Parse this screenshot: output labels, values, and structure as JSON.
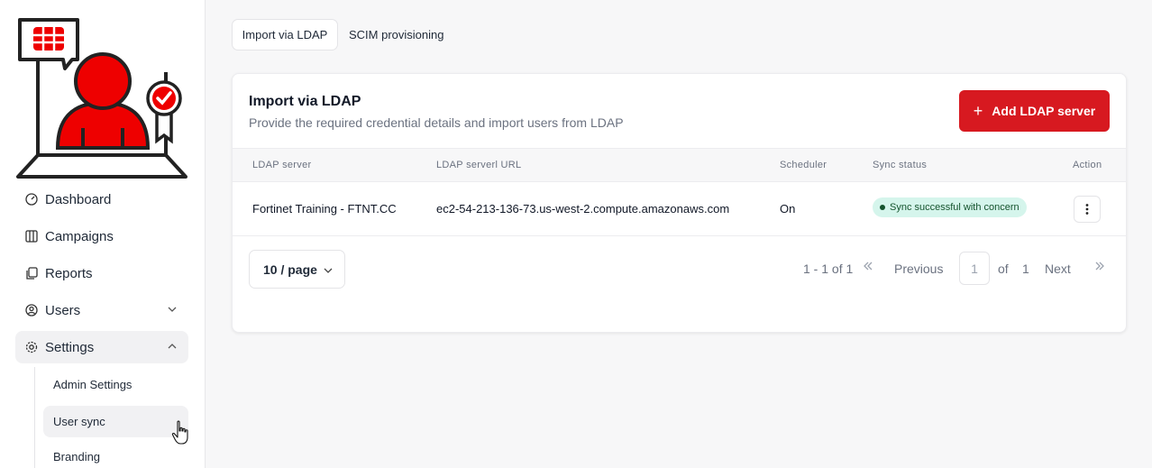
{
  "sidebar": {
    "items": [
      {
        "label": "Dashboard",
        "icon": "dashboard-icon"
      },
      {
        "label": "Campaigns",
        "icon": "campaigns-icon"
      },
      {
        "label": "Reports",
        "icon": "reports-icon"
      },
      {
        "label": "Users",
        "icon": "users-icon"
      },
      {
        "label": "Settings",
        "icon": "settings-icon"
      }
    ],
    "settings_sub": [
      {
        "label": "Admin Settings"
      },
      {
        "label": "User sync"
      },
      {
        "label": "Branding"
      }
    ]
  },
  "tabs": [
    {
      "label": "Import via LDAP",
      "active": true
    },
    {
      "label": "SCIM provisioning",
      "active": false
    }
  ],
  "card": {
    "title": "Import via LDAP",
    "subtitle": "Provide the required credential details and import users from LDAP",
    "add_button": "Add LDAP server"
  },
  "table": {
    "columns": [
      "LDAP server",
      "LDAP serverl URL",
      "Scheduler",
      "Sync status",
      "Action"
    ],
    "rows": [
      {
        "server": "Fortinet Training - FTNT.CC",
        "url": "ec2-54-213-136-73.us-west-2.compute.amazonaws.com",
        "scheduler": "On",
        "status": "Sync successful with concern"
      }
    ]
  },
  "pagination": {
    "page_size": "10 / page",
    "range": "1 - 1 of 1",
    "previous": "Previous",
    "current_page": "1",
    "of": "of",
    "total_pages": "1",
    "next": "Next"
  },
  "colors": {
    "brand_red": "#d71920",
    "status_bg": "#d5f5ec",
    "status_text": "#14532d"
  }
}
